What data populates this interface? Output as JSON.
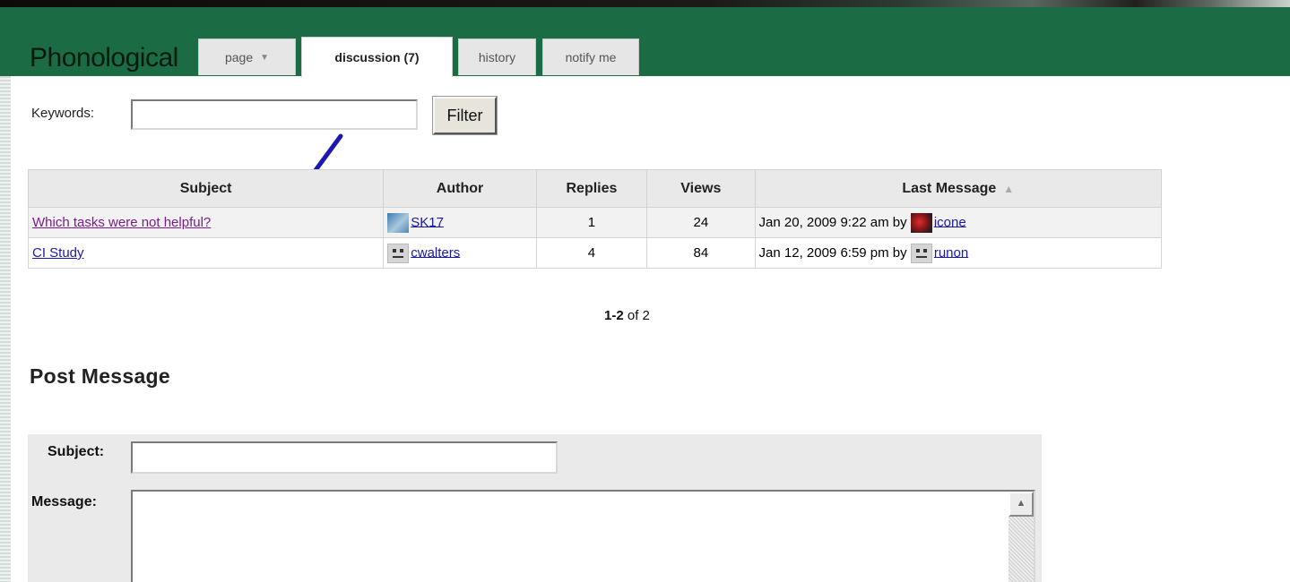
{
  "app": {
    "site_title": "Phonological"
  },
  "tabs": [
    {
      "label": "page",
      "has_dropdown": true
    },
    {
      "label": "discussion (7)",
      "active": true
    },
    {
      "label": "history"
    },
    {
      "label": "notify me"
    }
  ],
  "filter": {
    "keywords_label": "Keywords:",
    "keywords_value": "",
    "button_label": "Filter"
  },
  "table": {
    "headers": {
      "subject": "Subject",
      "author": "Author",
      "replies": "Replies",
      "views": "Views",
      "last_message": "Last Message"
    },
    "rows": [
      {
        "subject": "Which tasks were not helpful?",
        "author": "SK17",
        "replies": "1",
        "views": "24",
        "last_date": "Jan 20, 2009 9:22 am by",
        "last_user": "icone"
      },
      {
        "subject": "CI Study",
        "author": "cwalters",
        "replies": "4",
        "views": "84",
        "last_date": "Jan 12, 2009 6:59 pm by",
        "last_user": "runon"
      }
    ]
  },
  "pager": {
    "range": "1-2",
    "of": "of 2"
  },
  "post": {
    "title": "Post Message",
    "subject_label": "Subject:",
    "message_label": "Message:",
    "subject_value": "",
    "message_value": ""
  },
  "colors": {
    "header_green": "#1b6b44",
    "link": "#1a1aa6",
    "visited_link": "#7a1c8c",
    "annotation_arrow": "#1a1ab0"
  }
}
